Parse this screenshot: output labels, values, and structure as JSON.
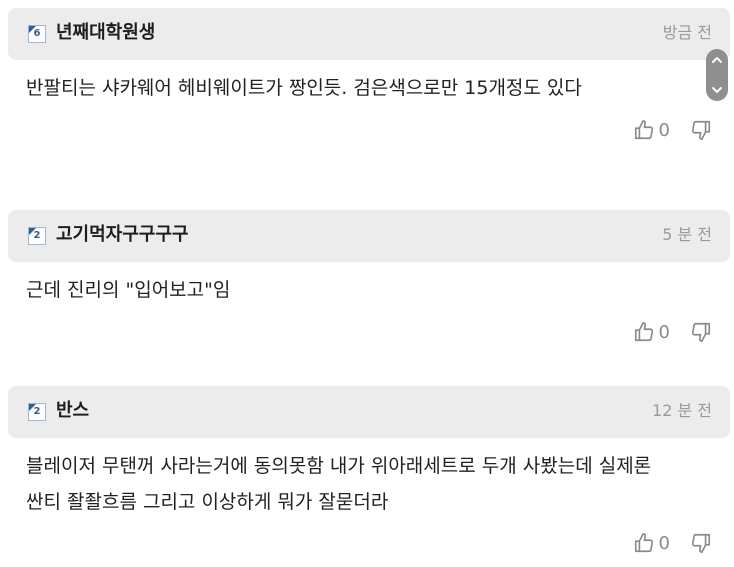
{
  "comments": [
    {
      "level": "6",
      "nickname": "년째대학원생",
      "time": "방금 전",
      "text_lines": [
        "반팔티는 샤카웨어 헤비웨이트가 짱인듯. 검은색으로만 15개정도 있다"
      ],
      "likes": "0"
    },
    {
      "level": "2",
      "nickname": "고기먹자구구구구",
      "time": "5 분 전",
      "text_lines": [
        "근데 진리의 \"입어보고\"임"
      ],
      "likes": "0"
    },
    {
      "level": "2",
      "nickname": "반스",
      "time": "12 분 전",
      "text_lines": [
        "블레이저 무탠꺼 사라는거에 동의못함 내가 위아래세트로 두개 사봤는데 실제론",
        "싼티 좔좔흐름 그리고 이상하게 뭐가 잘묻더라"
      ],
      "likes": "0"
    }
  ],
  "icons": {
    "like": "thumbs-up-icon",
    "dislike": "thumbs-down-icon",
    "scroll_up": "chevron-up-icon",
    "scroll_down": "chevron-down-icon"
  }
}
